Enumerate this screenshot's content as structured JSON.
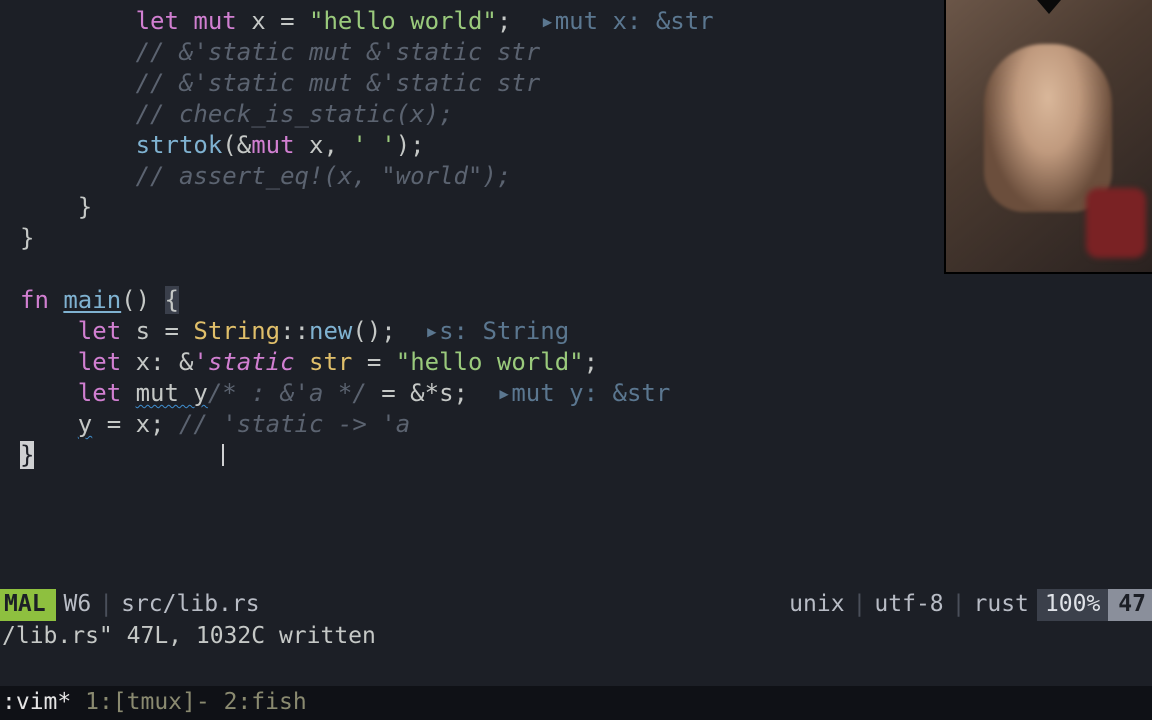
{
  "code": {
    "line1": {
      "indent": "        ",
      "kw_let": "let",
      "kw_mut": "mut",
      "var": " x ",
      "eq": "= ",
      "str": "\"hello world\"",
      "semi": ";",
      "hint_caret": "  ▸",
      "hint": "mut x: &str"
    },
    "line2": {
      "indent": "        ",
      "cmt": "// &'static mut &'static str"
    },
    "line3": {
      "indent": "        ",
      "cmt": "// &'static mut &'static str"
    },
    "line4": {
      "indent": "        ",
      "cmt": "// check_is_static(x);"
    },
    "line5": {
      "indent": "        ",
      "fn": "strtok",
      "open": "(",
      "amp": "&",
      "kw_mut": "mut",
      "var": " x, ",
      "ch": "' '",
      "close": ")",
      "semi": ";"
    },
    "line6": {
      "indent": "        ",
      "cmt": "// assert_eq!(x, \"world\");"
    },
    "line7": {
      "indent": "    ",
      "brace": "}"
    },
    "line8": {
      "brace": "}"
    },
    "line10": {
      "kw_fn": "fn",
      "name": "main",
      "parens": "()",
      "sp": " ",
      "brace": "{"
    },
    "line11": {
      "indent": "    ",
      "kw_let": "let",
      "var": " s ",
      "eq": "= ",
      "type": "String",
      "sep": "::",
      "fn": "new",
      "parens": "()",
      "semi": ";",
      "hint_caret": "  ▸",
      "hint": "s: String"
    },
    "line12": {
      "indent": "    ",
      "kw_let": "let",
      "var": " x",
      "colon": ": ",
      "amp": "&",
      "lt": "'static",
      "sp": " ",
      "ty": "str",
      "eq": " = ",
      "str": "\"hello world\"",
      "semi": ";"
    },
    "line13": {
      "indent": "    ",
      "kw_let": "let",
      "sp": " ",
      "mutvar": "mut y",
      "cmt": "/* : &'a */",
      "eq": " = ",
      "amp": "&*",
      "var": "s",
      "semi": ";",
      "hint_caret": "  ▸",
      "hint": "mut y: &str"
    },
    "line14": {
      "indent": "    ",
      "yvar": "y",
      "rest": " = x; ",
      "cmt": "// 'static -> 'a"
    },
    "line15": {
      "brace": "}"
    }
  },
  "status": {
    "mode": "MAL",
    "wn": "W6",
    "file": "src/lib.rs",
    "ff": "unix",
    "enc": "utf-8",
    "ft": "rust",
    "pct": "100%",
    "pos": "47"
  },
  "msg": "/lib.rs\" 47L, 1032C written",
  "tmux": {
    "session": ":vim*",
    "w1": " 1:[tmux]-",
    "w2": " 2:fish"
  }
}
